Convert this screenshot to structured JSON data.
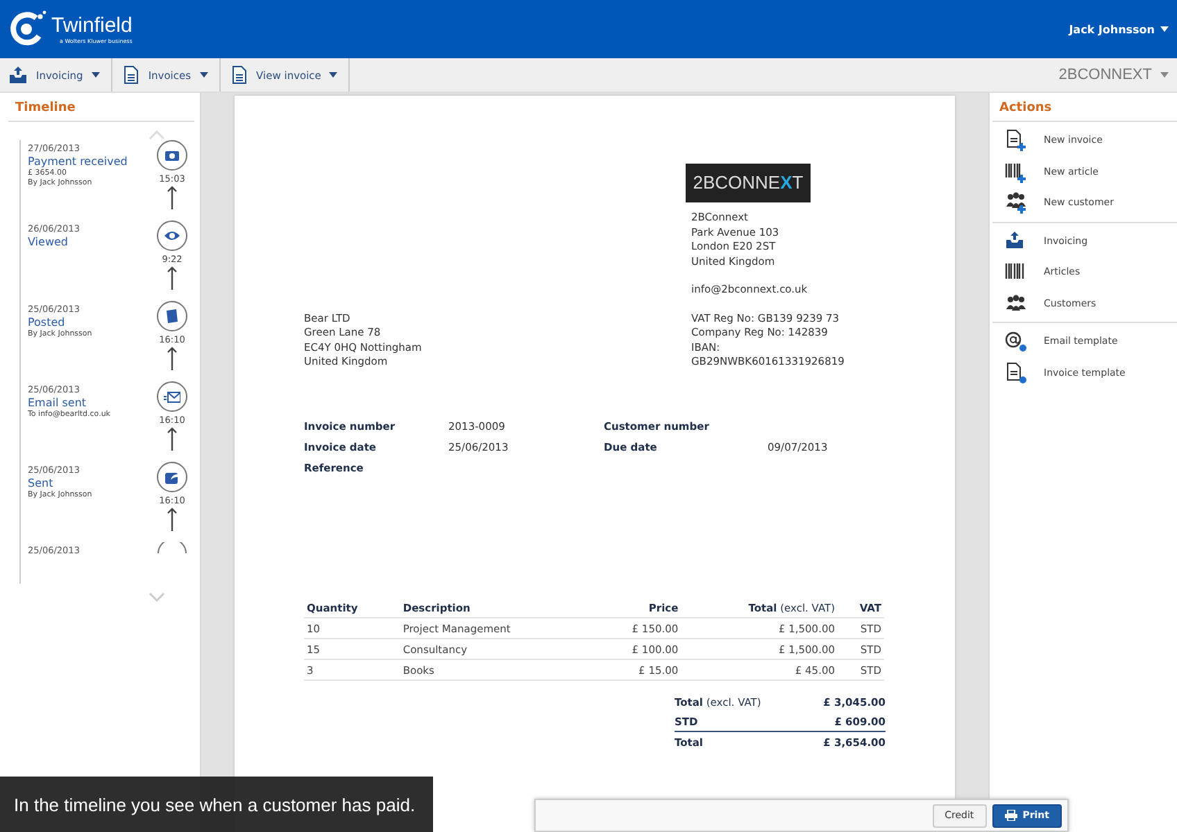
{
  "header": {
    "brand": "Twinfield",
    "tagline": "a Wolters Kluwer business",
    "user": "Jack Johnsson"
  },
  "breadcrumbs": [
    {
      "label": "Invoicing",
      "kind": "tray"
    },
    {
      "label": "Invoices",
      "kind": "document"
    },
    {
      "label": "View invoice",
      "kind": "document"
    }
  ],
  "company": "2BCONNEXT",
  "timeline": {
    "title": "Timeline",
    "events": [
      {
        "date": "27/06/2013",
        "title": "Payment received",
        "details": [
          "£ 3654.00",
          "By Jack Johnsson"
        ],
        "time": "15:03",
        "kind": "money"
      },
      {
        "date": "26/06/2013",
        "title": "Viewed",
        "time": "9:22",
        "kind": "eye"
      },
      {
        "date": "25/06/2013",
        "title": "Posted",
        "details": [
          "By Jack Johnsson"
        ],
        "time": "16:10",
        "kind": "book"
      },
      {
        "date": "25/06/2013",
        "title": "Email sent",
        "details": [
          "To info@bearltd.co.uk"
        ],
        "time": "16:10",
        "kind": "mail"
      },
      {
        "date": "25/06/2013",
        "title": "Sent",
        "details": [
          "By Jack Johnsson"
        ],
        "time": "16:10",
        "kind": "share"
      },
      {
        "date": "25/06/2013",
        "kind": "partial"
      }
    ]
  },
  "invoice": {
    "logo": {
      "before": "2BCONNE",
      "accent": "X",
      "after": "T"
    },
    "sender": [
      "2BConnext",
      "Park Avenue 103",
      "London E20 2ST",
      "United Kingdom"
    ],
    "email": "info@2bconnext.co.uk",
    "registration": [
      "VAT Reg No: GB139 9239 73",
      "Company Reg No: 142839",
      "IBAN:",
      "GB29NWBK60161331926819"
    ],
    "recipient": [
      "Bear LTD",
      "Green Lane 78",
      "EC4Y 0HQ Nottingham",
      "United Kingdom"
    ],
    "meta_left": [
      {
        "label": "Invoice number",
        "value": "2013-0009"
      },
      {
        "label": "Invoice date",
        "value": "25/06/2013"
      },
      {
        "label": "Reference"
      }
    ],
    "meta_right": [
      {
        "label": "Customer number"
      },
      {
        "label": "Due date",
        "value": "09/07/2013"
      }
    ],
    "table": {
      "columns": [
        "Quantity",
        "Description",
        "Price",
        "**Total** (excl. VAT)",
        "VAT"
      ],
      "rows": [
        [
          "10",
          "Project Management",
          "£ 150.00",
          "£ 1,500.00",
          "STD"
        ],
        [
          "15",
          "Consultancy",
          "£ 100.00",
          "£ 1,500.00",
          "STD"
        ],
        [
          "3",
          "Books",
          "£ 15.00",
          "£ 45.00",
          "STD"
        ]
      ]
    },
    "totals": [
      {
        "label": "**Total** (excl. VAT)",
        "value": "£ 3,045.00",
        "grand": false
      },
      {
        "label": "**STD**",
        "value": "£ 609.00",
        "grand": false
      },
      {
        "label": "**Total**",
        "value": "£ 3,654.00",
        "grand": true
      }
    ]
  },
  "buttons": [
    {
      "label": "Credit",
      "kind": "plain"
    },
    {
      "label": "Print",
      "kind": "primary"
    }
  ],
  "actions": {
    "title": "Actions",
    "groups": [
      [
        {
          "label": "New invoice",
          "kind": "doc-plus"
        },
        {
          "label": "New article",
          "kind": "barcode-plus"
        },
        {
          "label": "New customer",
          "kind": "people-plus"
        }
      ],
      [
        {
          "label": "Invoicing",
          "kind": "tray"
        },
        {
          "label": "Articles",
          "kind": "barcode"
        },
        {
          "label": "Customers",
          "kind": "people"
        }
      ],
      [
        {
          "label": "Email template",
          "kind": "at-gear"
        },
        {
          "label": "Invoice template",
          "kind": "doc-gear"
        }
      ]
    ]
  },
  "caption": "In the timeline you see when a customer has paid."
}
